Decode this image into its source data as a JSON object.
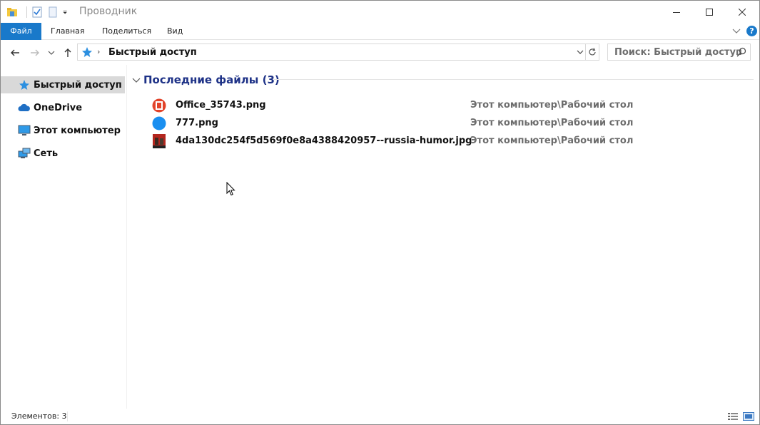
{
  "window": {
    "title": "Проводник"
  },
  "ribbon": {
    "tabs": [
      {
        "label": "Файл"
      },
      {
        "label": "Главная"
      },
      {
        "label": "Поделиться"
      },
      {
        "label": "Вид"
      }
    ],
    "help_label": "?"
  },
  "navbar": {
    "address": "Быстрый доступ",
    "breadcrumb_separator": "›",
    "search_placeholder": "Поиск: Быстрый доступ"
  },
  "sidebar": {
    "items": [
      {
        "label": "Быстрый доступ",
        "icon": "star-icon",
        "selected": true
      },
      {
        "label": "OneDrive",
        "icon": "cloud-icon"
      },
      {
        "label": "Этот компьютер",
        "icon": "computer-icon"
      },
      {
        "label": "Сеть",
        "icon": "network-icon"
      }
    ]
  },
  "main": {
    "group_title": "Последние файлы (3)",
    "files": [
      {
        "name": "Office_35743.png",
        "location": "Этот компьютер\\Рабочий стол",
        "icon": "office-icon"
      },
      {
        "name": "777.png",
        "location": "Этот компьютер\\Рабочий стол",
        "icon": "blue-circle-icon"
      },
      {
        "name": "4da130dc254f5d569f0e8a4388420957--russia-humor.jpg",
        "location": "Этот компьютер\\Рабочий стол",
        "icon": "image-thumbnail-icon"
      }
    ]
  },
  "status": {
    "items_text": "Элементов: 3"
  },
  "colors": {
    "accent": "#1979ca",
    "group_title": "#1e3287",
    "selection": "#d9d9d9"
  }
}
